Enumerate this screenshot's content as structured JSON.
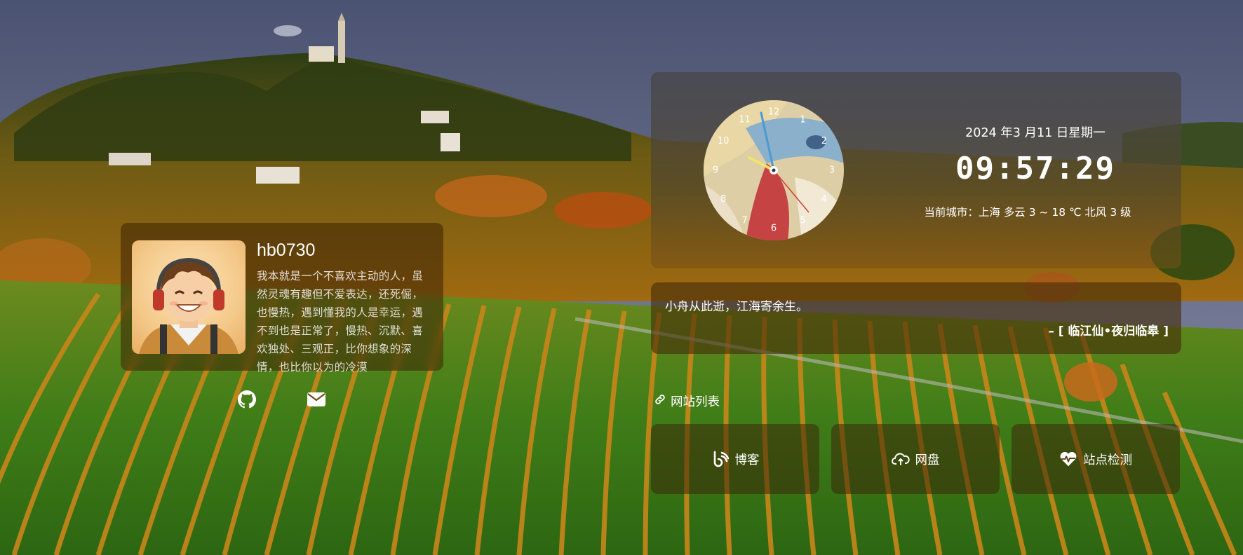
{
  "profile": {
    "username": "hb0730",
    "bio": "我本就是一个不喜欢主动的人，虽然灵魂有趣但不爱表达，还死倔，也慢热，遇到懂我的人是幸运，遇不到也是正常了，慢热、沉默、喜欢独处、三观正，比你想象的深情，也比你以为的冷漠"
  },
  "social": [
    {
      "icon": "github-icon"
    },
    {
      "icon": "mail-icon"
    }
  ],
  "clock": {
    "numbers": [
      "12",
      "1",
      "2",
      "3",
      "4",
      "5",
      "6",
      "7",
      "8",
      "9",
      "10",
      "11"
    ],
    "date": "2024 年3 月11 日星期一",
    "time": "09:57:29",
    "weather": "当前城市：上海 多云 3 ~ 18 ℃ 北风 3 级"
  },
  "quote": {
    "text": "小舟从此逝，江海寄余生。",
    "source": "– [ 临江仙•夜归临皋 ]"
  },
  "sites": {
    "header": "网站列表",
    "header_icon": "link-icon",
    "items": [
      {
        "label": "博客",
        "icon": "blog-icon"
      },
      {
        "label": "网盘",
        "icon": "cloud-icon"
      },
      {
        "label": "站点检测",
        "icon": "heart-pulse-icon"
      }
    ]
  }
}
